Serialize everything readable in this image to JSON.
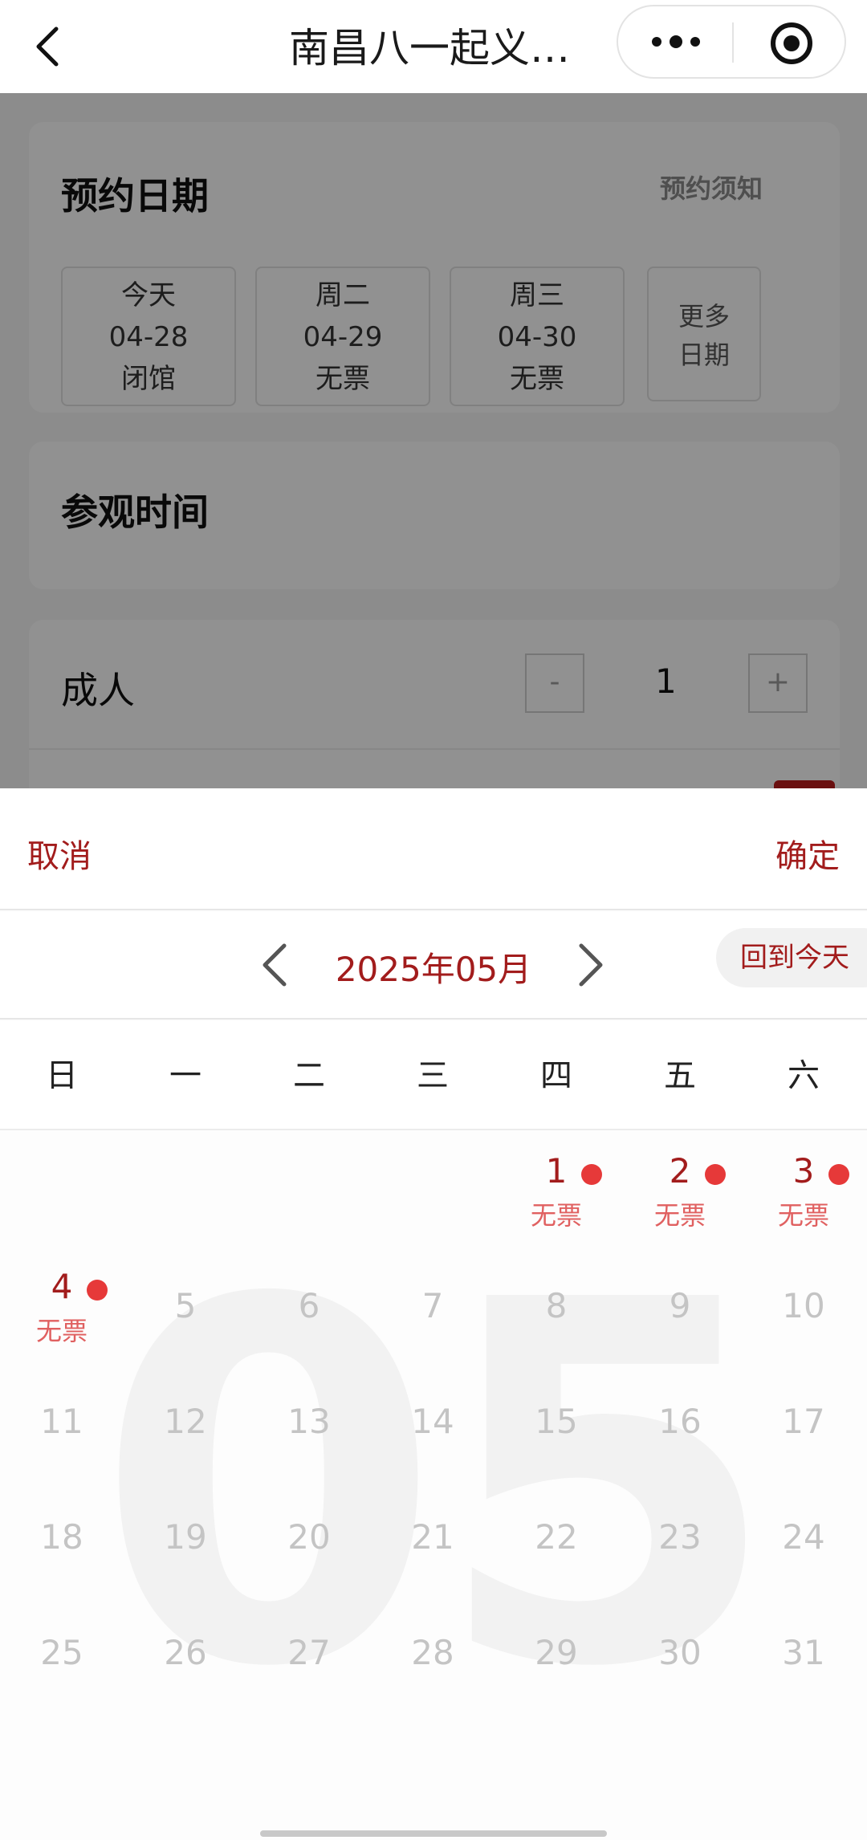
{
  "nav": {
    "title": "南昌八一起义…",
    "back_icon": "chevron-left-icon",
    "more_icon": "more-dots-icon",
    "close_icon": "target-close-icon"
  },
  "date_card": {
    "title": "预约日期",
    "notice": "预约须知",
    "dates": [
      {
        "day": "今天",
        "date": "04-28",
        "status": "闭馆"
      },
      {
        "day": "周二",
        "date": "04-29",
        "status": "无票"
      },
      {
        "day": "周三",
        "date": "04-30",
        "status": "无票"
      }
    ],
    "more_line1": "更多",
    "more_line2": "日期"
  },
  "time_card": {
    "title": "参观时间"
  },
  "adult_card": {
    "label": "成人",
    "minus": "-",
    "value": "1",
    "plus": "+"
  },
  "sheet": {
    "cancel": "取消",
    "confirm": "确定",
    "month": "2025年05月",
    "today": "回到今天",
    "weekdays": [
      "日",
      "一",
      "二",
      "三",
      "四",
      "五",
      "六"
    ],
    "watermark": "05",
    "days": [
      {
        "num": "1",
        "tag": "无票"
      },
      {
        "num": "2",
        "tag": "无票"
      },
      {
        "num": "3",
        "tag": "无票"
      },
      {
        "num": "4",
        "tag": "无票"
      },
      {
        "num": "5"
      },
      {
        "num": "6"
      },
      {
        "num": "7"
      },
      {
        "num": "8"
      },
      {
        "num": "9"
      },
      {
        "num": "10"
      },
      {
        "num": "11"
      },
      {
        "num": "12"
      },
      {
        "num": "13"
      },
      {
        "num": "14"
      },
      {
        "num": "15"
      },
      {
        "num": "16"
      },
      {
        "num": "17"
      },
      {
        "num": "18"
      },
      {
        "num": "19"
      },
      {
        "num": "20"
      },
      {
        "num": "21"
      },
      {
        "num": "22"
      },
      {
        "num": "23"
      },
      {
        "num": "24"
      },
      {
        "num": "25"
      },
      {
        "num": "26"
      },
      {
        "num": "27"
      },
      {
        "num": "28"
      },
      {
        "num": "29"
      },
      {
        "num": "30"
      },
      {
        "num": "31"
      }
    ]
  },
  "colors": {
    "accent": "#a21c1c",
    "dot": "#e63939"
  }
}
